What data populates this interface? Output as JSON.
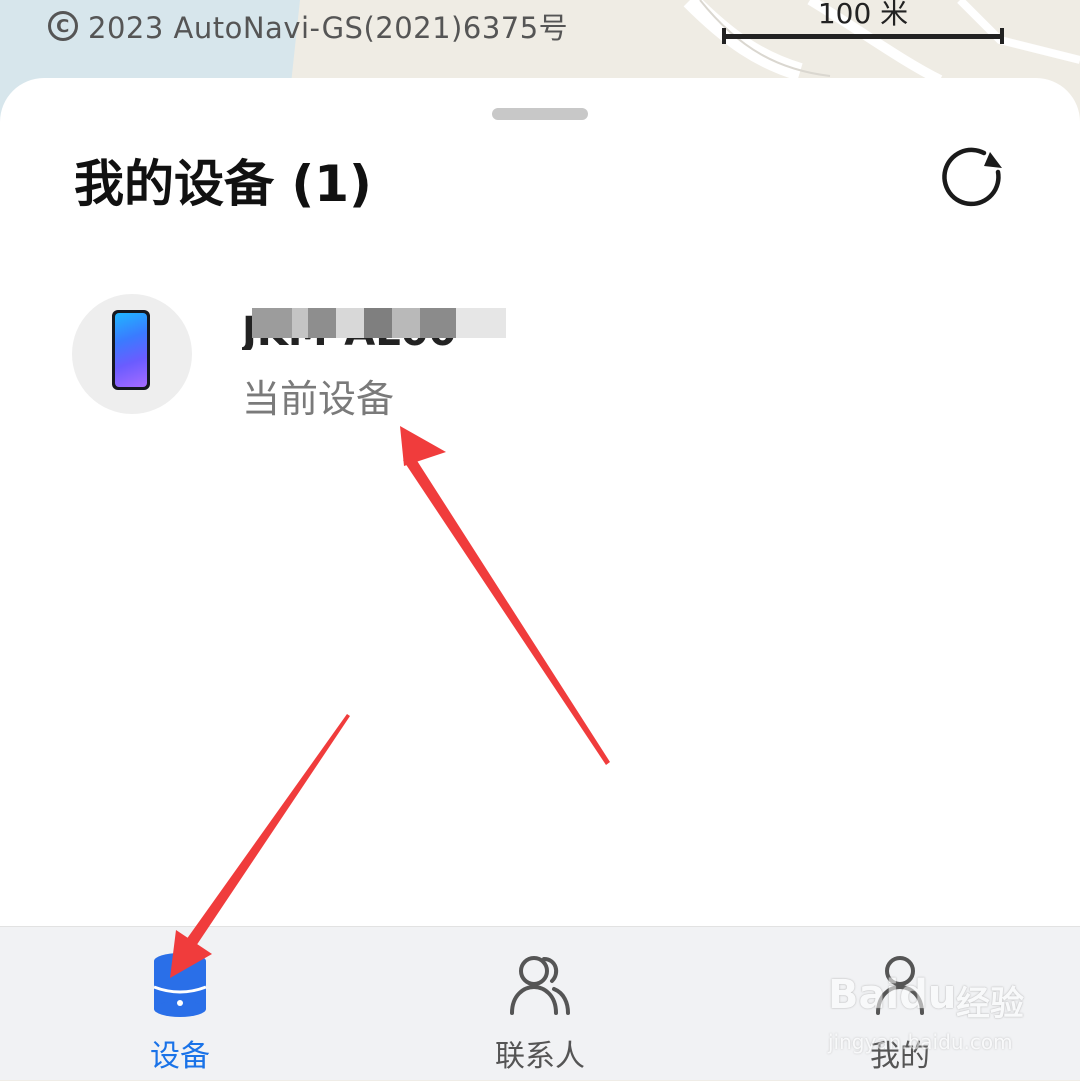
{
  "map": {
    "copyright_text": "2023 AutoNavi-GS(2021)6375号",
    "scale_label": "100 米"
  },
  "sheet": {
    "title": "我的设备 (1)",
    "refresh_icon": "refresh-icon"
  },
  "devices": [
    {
      "name": "JKM-AL00",
      "status": "当前设备",
      "icon": "phone-icon"
    }
  ],
  "bottom_nav": {
    "items": [
      {
        "label": "设备",
        "icon": "device-icon",
        "active": true
      },
      {
        "label": "联系人",
        "icon": "contacts-icon",
        "active": false
      },
      {
        "label": "我的",
        "icon": "person-icon",
        "active": false
      }
    ]
  },
  "watermark": {
    "brand": "Baidu",
    "text": "经验",
    "url": "jingyan.baidu.com"
  },
  "colors": {
    "accent": "#1a73e8",
    "annotation": "#f03c3c",
    "sheet_bg": "#ffffff",
    "nav_bg": "#f1f2f4"
  }
}
